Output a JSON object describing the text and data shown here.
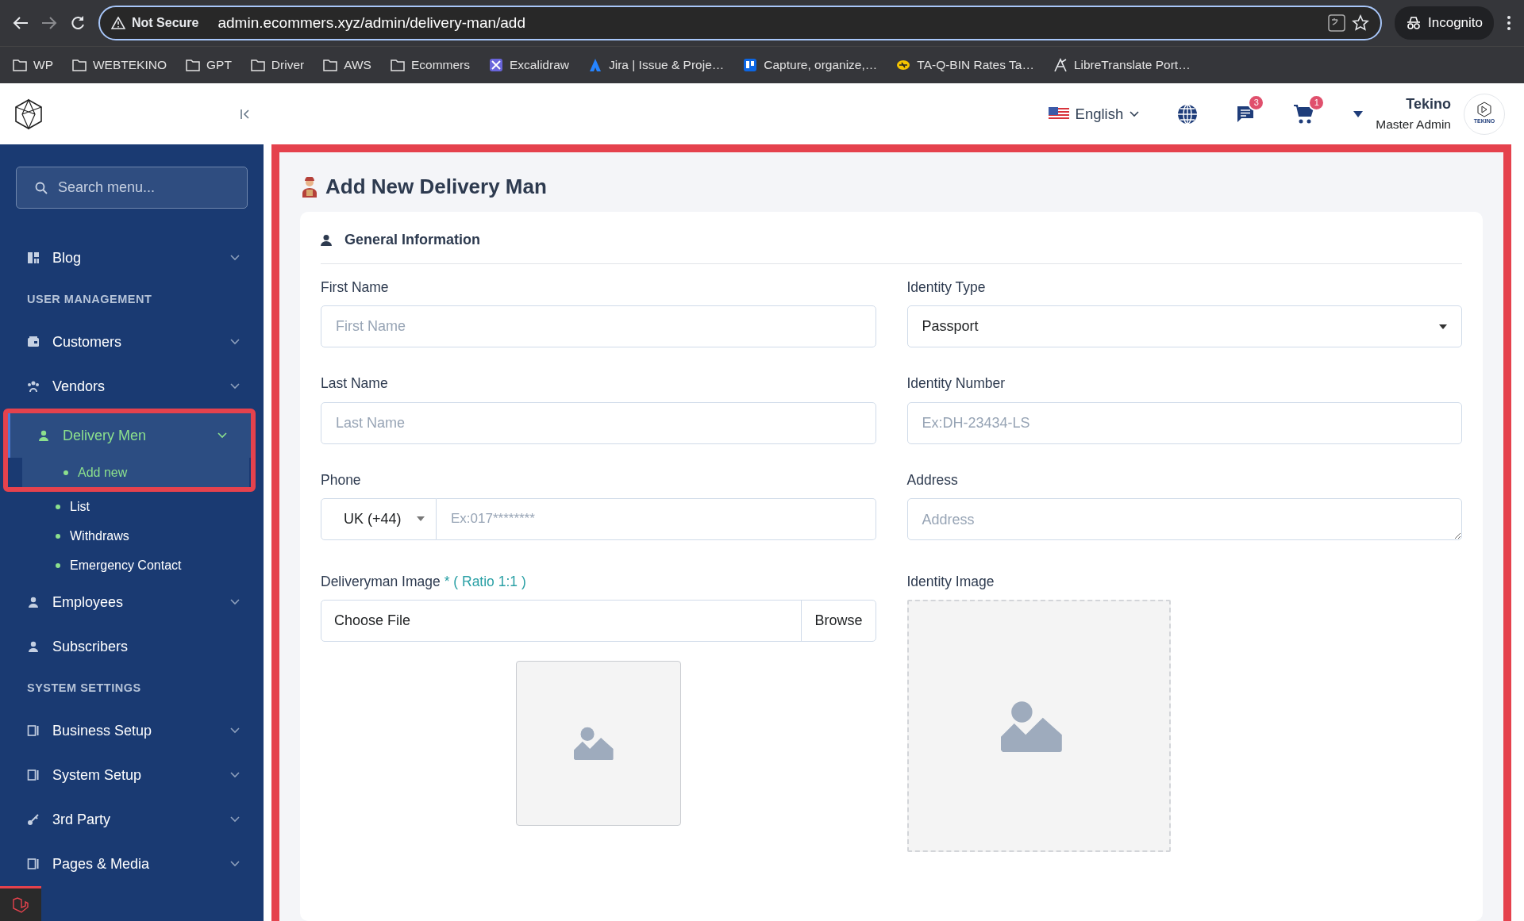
{
  "browser": {
    "security": "Not Secure",
    "url": "admin.ecommers.xyz/admin/delivery-man/add",
    "profile": "Incognito",
    "bookmarks": [
      {
        "label": "WP",
        "kind": "folder"
      },
      {
        "label": "WEBTEKINO",
        "kind": "folder"
      },
      {
        "label": "GPT",
        "kind": "folder"
      },
      {
        "label": "Driver",
        "kind": "folder"
      },
      {
        "label": "AWS",
        "kind": "folder"
      },
      {
        "label": "Ecommers",
        "kind": "folder"
      },
      {
        "label": "Excalidraw",
        "kind": "site"
      },
      {
        "label": "Jira | Issue & Proje…",
        "kind": "site"
      },
      {
        "label": "Capture, organize,…",
        "kind": "site"
      },
      {
        "label": "TA-Q-BIN Rates Ta…",
        "kind": "site"
      },
      {
        "label": "LibreTranslate Port…",
        "kind": "site"
      }
    ]
  },
  "header": {
    "language": "English",
    "messages_count": "3",
    "cart_count": "1",
    "user_name": "Tekino",
    "user_role": "Master Admin",
    "avatar_text": "TEKINO"
  },
  "sidebar": {
    "search_placeholder": "Search menu...",
    "items": [
      {
        "kind": "group",
        "label": "Blog",
        "expanded": false,
        "selected": false,
        "highlighted": false
      },
      {
        "kind": "section",
        "label": "USER MANAGEMENT"
      },
      {
        "kind": "group",
        "label": "Customers",
        "expanded": false,
        "selected": false,
        "highlighted": false
      },
      {
        "kind": "group",
        "label": "Vendors",
        "expanded": false,
        "selected": false,
        "highlighted": false
      },
      {
        "kind": "group",
        "label": "Delivery Men",
        "expanded": true,
        "selected": true,
        "highlighted": true,
        "children": [
          {
            "label": "Add new",
            "selected": true
          },
          {
            "label": "List",
            "selected": false
          },
          {
            "label": "Withdraws",
            "selected": false
          },
          {
            "label": "Emergency Contact",
            "selected": false
          }
        ]
      },
      {
        "kind": "group",
        "label": "Employees",
        "expanded": false,
        "selected": false,
        "highlighted": false
      },
      {
        "kind": "link",
        "label": "Subscribers",
        "selected": false,
        "highlighted": false
      },
      {
        "kind": "section",
        "label": "SYSTEM SETTINGS"
      },
      {
        "kind": "group",
        "label": "Business Setup",
        "expanded": false,
        "selected": false,
        "highlighted": false
      },
      {
        "kind": "group",
        "label": "System Setup",
        "expanded": false,
        "selected": false,
        "highlighted": false
      },
      {
        "kind": "group",
        "label": "3rd Party",
        "expanded": false,
        "selected": false,
        "highlighted": false
      },
      {
        "kind": "group",
        "label": "Pages & Media",
        "expanded": false,
        "selected": false,
        "highlighted": false
      }
    ]
  },
  "page": {
    "title": "Add New Delivery Man",
    "highlighted": true,
    "section_title": "General Information",
    "fields": [
      {
        "kind": "text",
        "label": "First Name",
        "placeholder": "First Name"
      },
      {
        "kind": "select",
        "label": "Identity Type",
        "value": "Passport"
      },
      {
        "kind": "text",
        "label": "Last Name",
        "placeholder": "Last Name"
      },
      {
        "kind": "text",
        "label": "Identity Number",
        "placeholder": "Ex:DH-23434-LS"
      },
      {
        "kind": "phone",
        "label": "Phone",
        "country_code": "UK (+44)",
        "placeholder": "Ex:017********"
      },
      {
        "kind": "textarea",
        "label": "Address",
        "placeholder": "Address"
      },
      {
        "kind": "file",
        "label": "Deliveryman Image",
        "hint": "* ( Ratio 1:1 )",
        "value": "Choose File",
        "button": "Browse"
      },
      {
        "kind": "image",
        "label": "Identity Image"
      }
    ]
  }
}
